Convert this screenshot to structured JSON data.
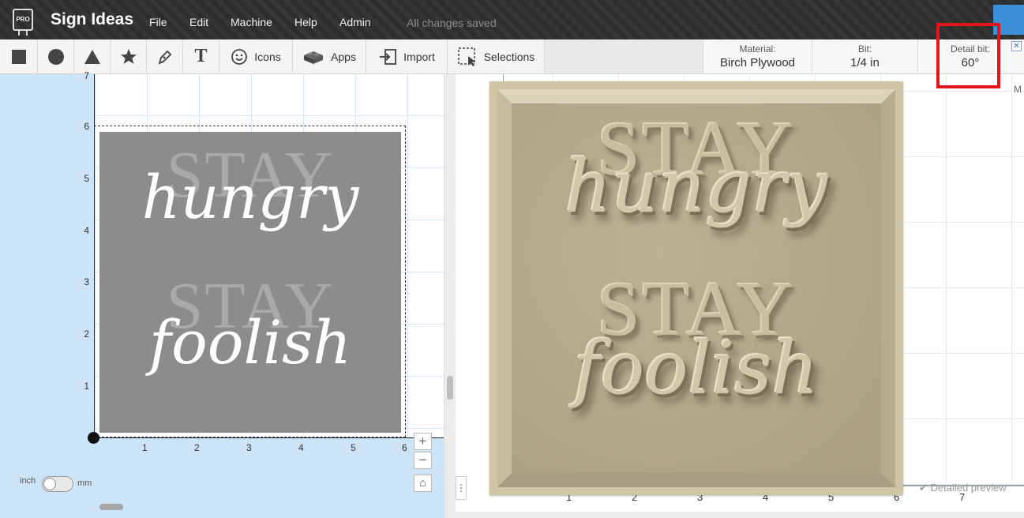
{
  "app": {
    "logo_text": "PRO",
    "title": "Sign Ideas",
    "menu": [
      "File",
      "Edit",
      "Machine",
      "Help",
      "Admin"
    ],
    "save_status": "All changes saved"
  },
  "toolbar": {
    "shape_tools": [
      "square-tool",
      "circle-tool",
      "triangle-tool",
      "star-tool",
      "pen-tool"
    ],
    "text_glyph": "T",
    "icons_label": "Icons",
    "apps_label": "Apps",
    "import_label": "Import",
    "selections_label": "Selections",
    "material": {
      "label": "Material:",
      "value": "Birch Plywood"
    },
    "bit": {
      "label": "Bit:",
      "value": "1/4 in"
    },
    "detail_bit": {
      "label": "Detail bit:",
      "value": "60°"
    },
    "close_glyph": "✕"
  },
  "canvas": {
    "y_ruler": [
      "7",
      "6",
      "5",
      "4",
      "3",
      "2",
      "1"
    ],
    "x_ruler": [
      "1",
      "2",
      "3",
      "4",
      "5",
      "6"
    ],
    "design": {
      "line1": "STAY",
      "line2": "hungry",
      "line3": "STAY",
      "line4": "foolish"
    },
    "zoom_in": "+",
    "zoom_out": "−",
    "home_glyph": "⌂",
    "unit_left": "inch",
    "unit_right": "mm"
  },
  "preview": {
    "x_ruler": [
      "1",
      "2",
      "3",
      "4",
      "5",
      "6",
      "7"
    ],
    "corner_letter": "M",
    "detailed_preview_label": "Detailed preview",
    "panel_toggle_glyph": "⋮"
  },
  "colors": {
    "menubar": "#2f2f2f",
    "left_canvas_bg": "#cce4f7",
    "design_fill": "#8c8c8c",
    "wood": "#cfc4a4",
    "highlight": "#e3141a"
  }
}
